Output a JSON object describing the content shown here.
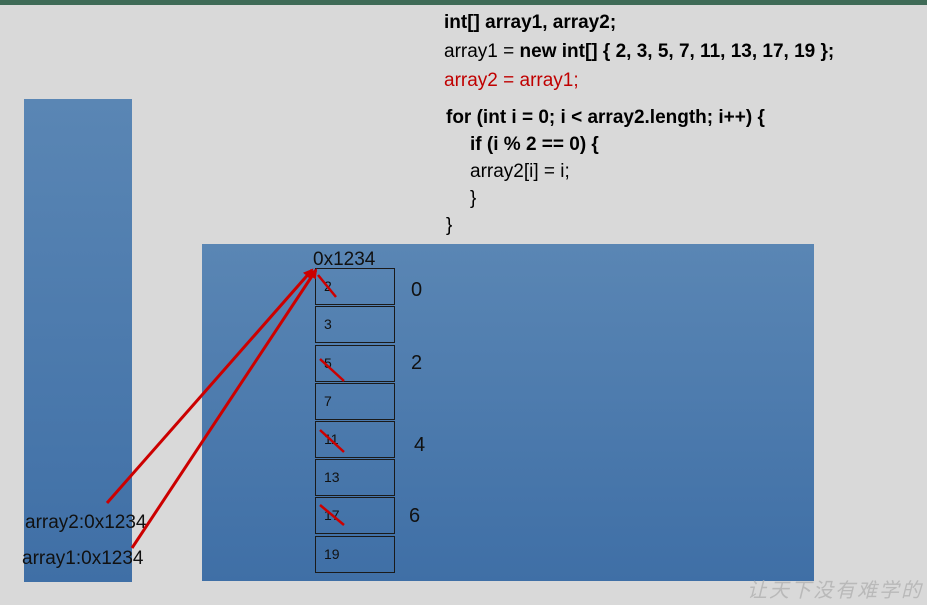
{
  "code": {
    "line1": "int[] array1, array2;",
    "line2_a": "array1 = ",
    "line2_b": "new int[] { 2, 3, 5, 7, 11, 13, 17, 19 };",
    "line3": "array2 = array1;",
    "line4": "for (int i = 0; i < array2.length; i++) {",
    "line5": "if (i % 2 == 0) {",
    "line6": "array2[i] = i;",
    "line7": "}",
    "line8": "}"
  },
  "heap": {
    "address": "0x1234",
    "cells": [
      "2",
      "3",
      "5",
      "7",
      "11",
      "13",
      "17",
      "19"
    ],
    "indices": [
      "0",
      "2",
      "4",
      "6"
    ]
  },
  "stack": {
    "array2_ref": "array2:0x1234",
    "array1_ref": "array1:0x1234"
  },
  "watermark": "让天下没有难学的",
  "colors": {
    "arrow": "#cc0000",
    "highlight": "#c00000",
    "panel": "#4a7aad"
  }
}
